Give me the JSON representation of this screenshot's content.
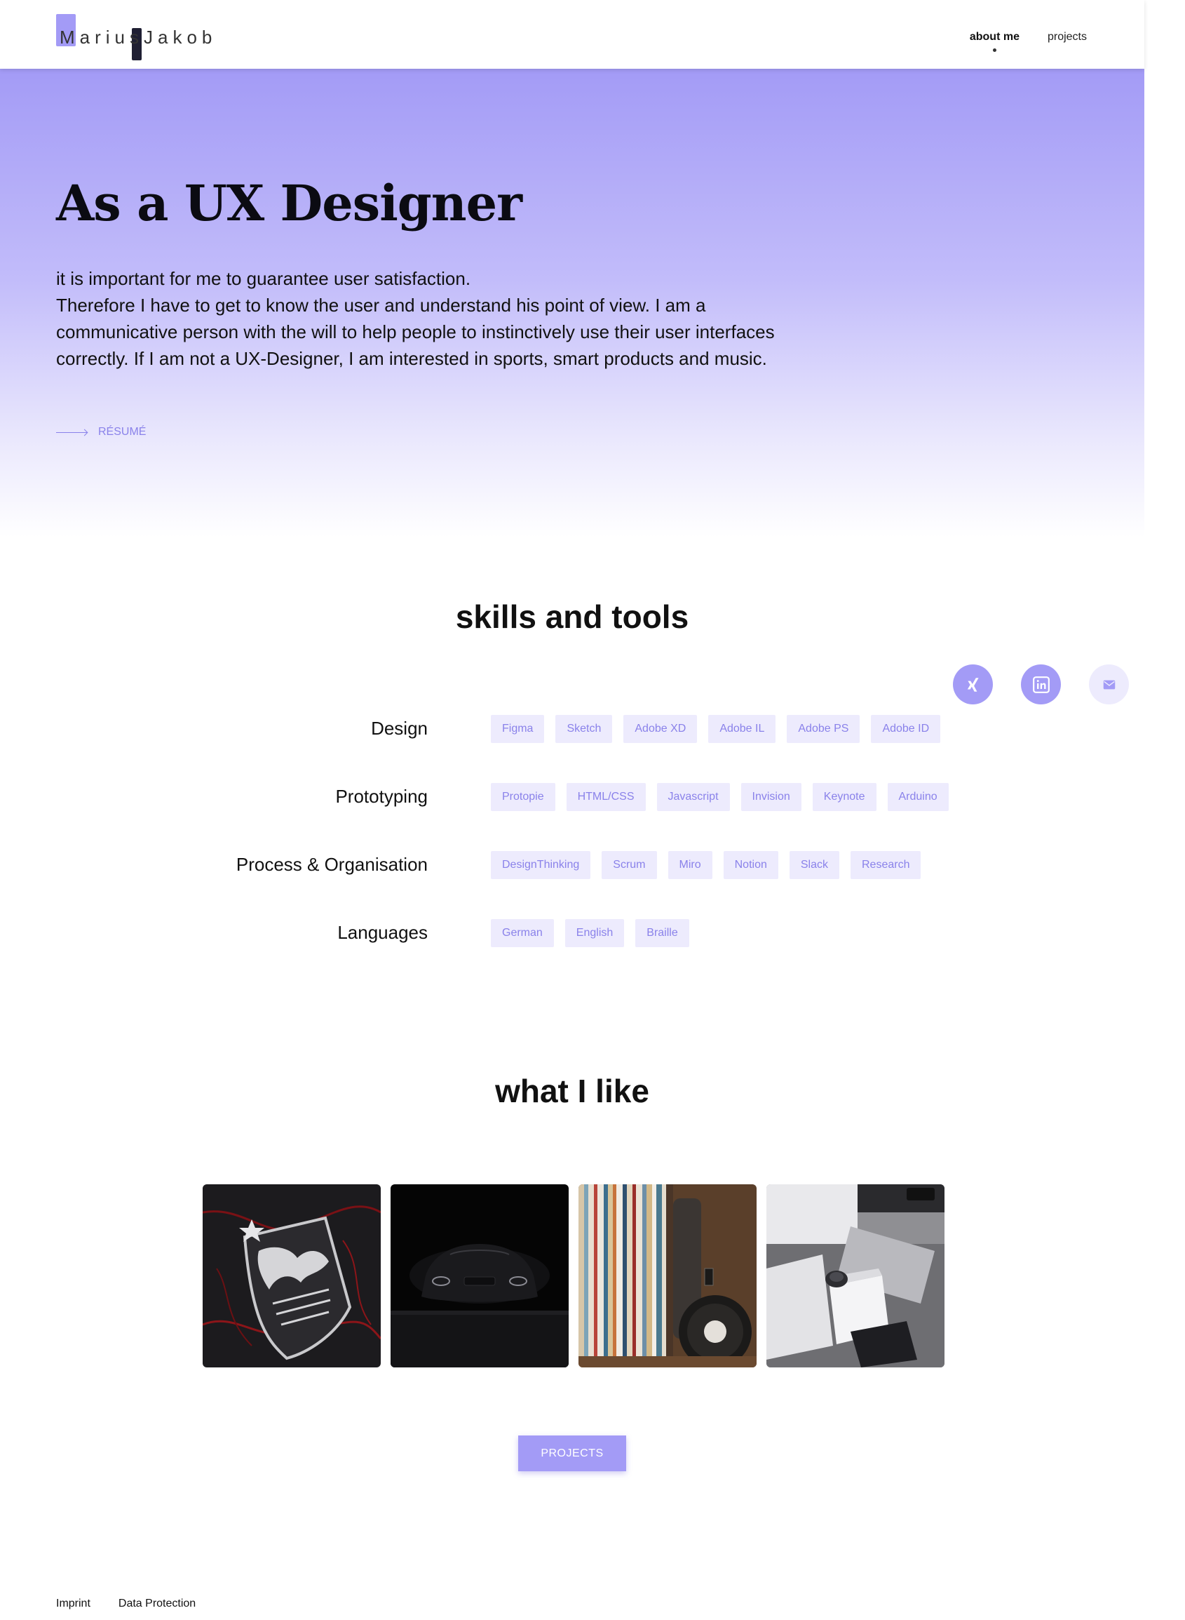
{
  "header": {
    "logo_text": "MariusJakob",
    "nav": [
      {
        "label": "about me",
        "active": true
      },
      {
        "label": "projects",
        "active": false
      }
    ]
  },
  "hero": {
    "title": "As a UX Designer",
    "paragraph_lines": [
      "it is important for me to guarantee user satisfaction.",
      "Therefore I have to get to know the user and understand his point of view. I am a communicative person with the will to help people to instinctively use their user interfaces correctly. If I am not a UX-Designer, I am interested in sports, smart products and music."
    ],
    "resume_label": "RÉSUMÉ"
  },
  "skills": {
    "title": "skills and tools",
    "social_icons": [
      "xing-icon",
      "linkedin-icon",
      "mail-icon"
    ],
    "rows": [
      {
        "label": "Design",
        "tags": [
          "Figma",
          "Sketch",
          "Adobe XD",
          "Adobe IL",
          "Adobe PS",
          "Adobe ID"
        ]
      },
      {
        "label": "Prototyping",
        "tags": [
          "Protopie",
          "HTML/CSS",
          "Javascript",
          "Invision",
          "Keynote",
          "Arduino"
        ]
      },
      {
        "label": "Process & Organisation",
        "tags": [
          "DesignThinking",
          "Scrum",
          "Miro",
          "Notion",
          "Slack",
          "Research"
        ]
      },
      {
        "label": "Languages",
        "tags": [
          "German",
          "English",
          "Braille"
        ]
      }
    ]
  },
  "likes": {
    "title": "what I like",
    "photos": [
      "football-crest-photo",
      "dark-car-photo",
      "vinyl-records-headphones-photo",
      "apple-devices-photo"
    ]
  },
  "cta_label": "PROJECTS",
  "footer": {
    "links": [
      "Imprint",
      "Data Protection"
    ]
  },
  "colors": {
    "accent": "#a39bf6",
    "tag_bg": "#edebfd",
    "tag_text": "#8a82ea",
    "dark": "#1f1f33"
  }
}
